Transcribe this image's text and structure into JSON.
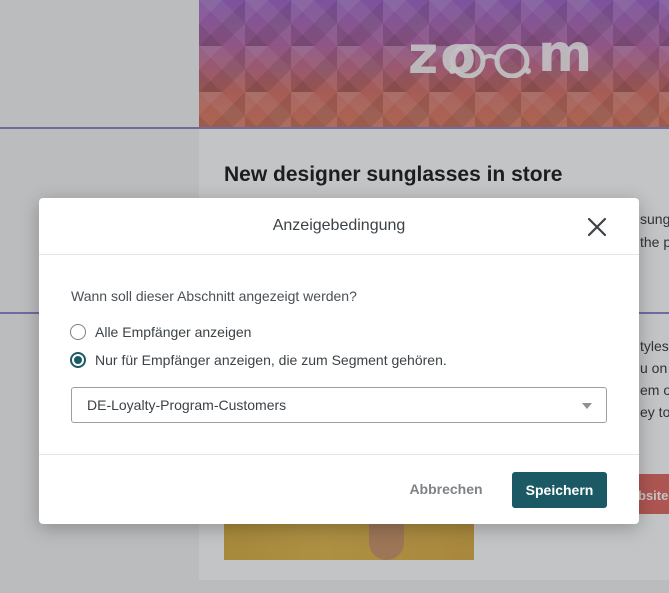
{
  "background": {
    "logo_text": "zo",
    "logo_text_end": "m",
    "headline": "New designer sunglasses in store",
    "body_snippets": [
      "sung",
      "the p",
      "tyles",
      "u on",
      "em ou",
      "ey to"
    ],
    "cta_label": "bsite"
  },
  "modal": {
    "title": "Anzeigebedingung",
    "close_icon": "close-icon",
    "question": "Wann soll dieser Abschnitt angezeigt werden?",
    "options": [
      {
        "label": "Alle Empfänger anzeigen",
        "checked": false
      },
      {
        "label": "Nur für Empfänger anzeigen, die zum Segment gehören.",
        "checked": true
      }
    ],
    "segment_select": {
      "value": "DE-Loyalty-Program-Customers",
      "icon": "chevron-down-icon"
    },
    "cancel_label": "Abbrechen",
    "save_label": "Speichern"
  },
  "colors": {
    "primary": "#1b5a64",
    "cta": "#e0615a",
    "divider": "#8b7fc7"
  }
}
